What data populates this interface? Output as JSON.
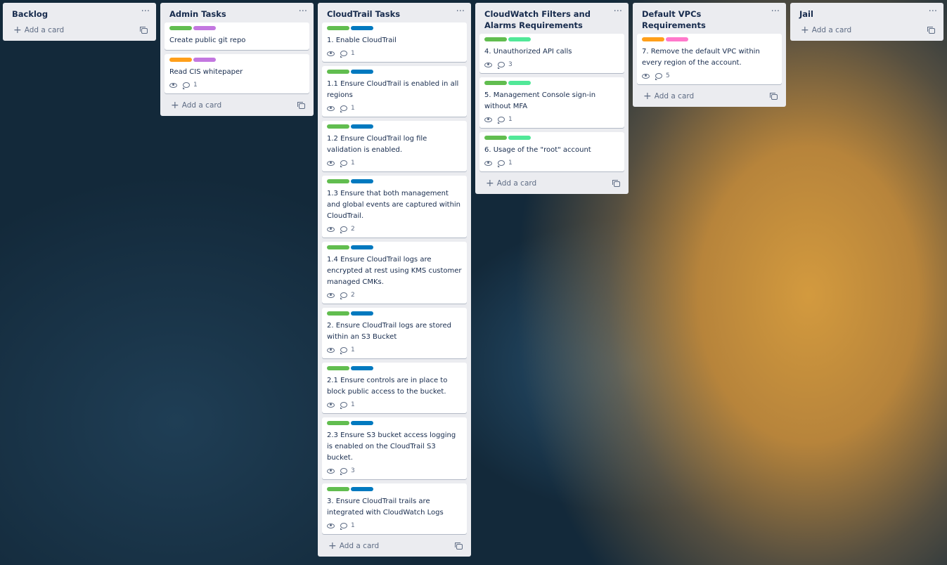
{
  "colors": {
    "green": "#61bd4f",
    "blue": "#0079bf",
    "purple": "#c377e0",
    "orange": "#ff9f1a",
    "lime": "#51e898",
    "pink": "#ff78cb"
  },
  "list_menu_glyph": "···",
  "add_card_label": "Add a card",
  "lists": [
    {
      "title": "Backlog",
      "cards": []
    },
    {
      "title": "Admin Tasks",
      "cards": [
        {
          "labels": [
            "green",
            "purple"
          ],
          "title": "Create public git repo"
        },
        {
          "labels": [
            "orange",
            "purple"
          ],
          "title": "Read CIS whitepaper",
          "watch": true,
          "comments": "1"
        }
      ]
    },
    {
      "title": "CloudTrail Tasks",
      "cards": [
        {
          "labels": [
            "green",
            "blue"
          ],
          "title": "1. Enable CloudTrail",
          "watch": true,
          "comments": "1"
        },
        {
          "labels": [
            "green",
            "blue"
          ],
          "title": "1.1 Ensure CloudTrail is enabled in all regions",
          "watch": true,
          "comments": "1"
        },
        {
          "labels": [
            "green",
            "blue"
          ],
          "title": "1.2 Ensure CloudTrail log file validation is enabled.",
          "watch": true,
          "comments": "1"
        },
        {
          "labels": [
            "green",
            "blue"
          ],
          "title": "1.3 Ensure that both management and global events are captured within CloudTrail.",
          "watch": true,
          "comments": "2"
        },
        {
          "labels": [
            "green",
            "blue"
          ],
          "title": "1.4 Ensure CloudTrail logs are encrypted at rest using KMS customer managed CMKs.",
          "watch": true,
          "comments": "2"
        },
        {
          "labels": [
            "green",
            "blue"
          ],
          "title": "2. Ensure CloudTrail logs are stored within an S3 Bucket",
          "watch": true,
          "comments": "1"
        },
        {
          "labels": [
            "green",
            "blue"
          ],
          "title": "2.1 Ensure controls are in place to block public access to the bucket.",
          "watch": true,
          "comments": "1"
        },
        {
          "labels": [
            "green",
            "blue"
          ],
          "title": "2.3 Ensure S3 bucket access logging is enabled on the CloudTrail S3 bucket.",
          "watch": true,
          "comments": "3"
        },
        {
          "labels": [
            "green",
            "blue"
          ],
          "title": "3. Ensure CloudTrail trails are integrated with CloudWatch Logs",
          "watch": true,
          "comments": "1"
        }
      ]
    },
    {
      "title": "CloudWatch Filters and Alarms Requirements",
      "cards": [
        {
          "labels": [
            "green",
            "lime"
          ],
          "title": "4. Unauthorized API calls",
          "watch": true,
          "comments": "3"
        },
        {
          "labels": [
            "green",
            "lime"
          ],
          "title": "5. Management Console sign-in without MFA",
          "watch": true,
          "comments": "1"
        },
        {
          "labels": [
            "green",
            "lime"
          ],
          "title": "6. Usage of the \"root\" account",
          "watch": true,
          "comments": "1"
        }
      ]
    },
    {
      "title": "Default VPCs Requirements",
      "cards": [
        {
          "labels": [
            "orange",
            "pink"
          ],
          "title": "7. Remove the default VPC within every region of the account.",
          "watch": true,
          "comments": "5"
        }
      ]
    },
    {
      "title": "Jail",
      "cards": []
    }
  ]
}
